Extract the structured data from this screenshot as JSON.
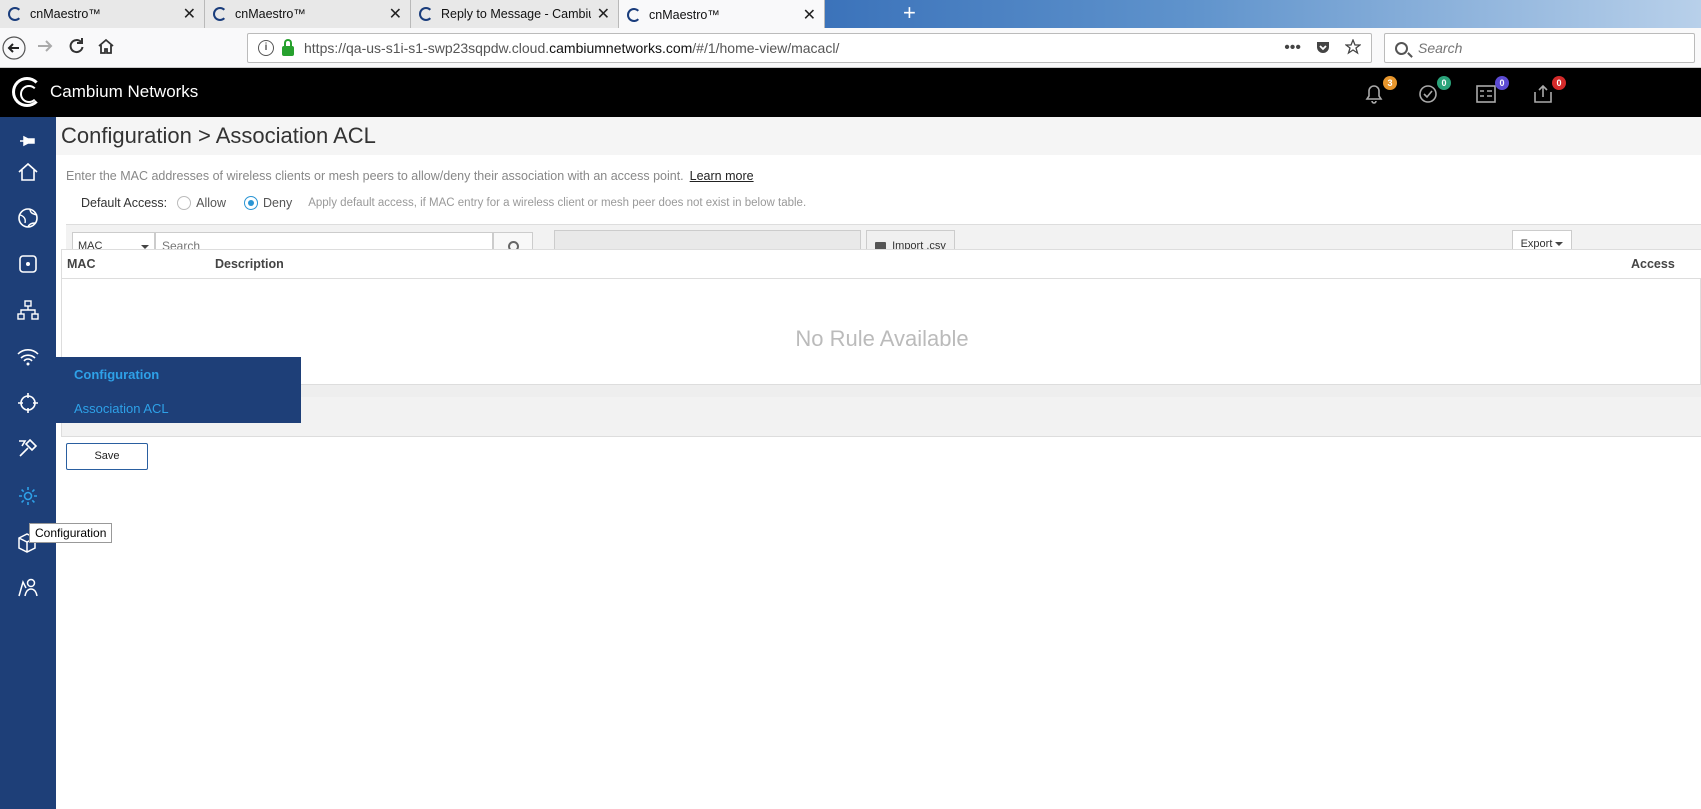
{
  "browser": {
    "tabs": [
      {
        "label": "cnMaestro™",
        "active": false
      },
      {
        "label": "cnMaestro™",
        "active": false
      },
      {
        "label": "Reply to Message - Cambium N",
        "active": false
      },
      {
        "label": "cnMaestro™",
        "active": true
      }
    ],
    "close_glyph": "✕",
    "new_tab_glyph": "+",
    "url_prefix": "https://qa-us-s1i-s1-swp23sqpdw.cloud.",
    "url_domain": "cambiumnetworks.com",
    "url_suffix": "/#/1/home-view/macacl/",
    "search_placeholder": "Search"
  },
  "app": {
    "brand": "Cambium Networks",
    "header_badges": {
      "alarms": "3",
      "tasks": "0",
      "jobs": "0",
      "updates": "0"
    },
    "badge_colors": {
      "alarms": "#e8962c",
      "tasks": "#2aa37a",
      "jobs": "#5c4bd3",
      "updates": "#d42a2a"
    }
  },
  "sidebar": {
    "items": [
      "pin-icon",
      "home-icon",
      "globe-icon",
      "device-icon",
      "network-icon",
      "wifi-icon",
      "target-icon",
      "tools-icon",
      "gear-icon",
      "box-add-icon",
      "users-icon"
    ],
    "tooltip": "Configuration",
    "flyout_title": "Configuration",
    "flyout_item": "Association ACL"
  },
  "page": {
    "title": "Configuration > Association ACL",
    "description": "Enter the MAC addresses of wireless clients or mesh peers to allow/deny their association with an access point.",
    "learn_more": "Learn more",
    "default_access_label": "Default Access:",
    "allow_label": "Allow",
    "deny_label": "Deny",
    "selected": "Deny",
    "hint": "Apply default access, if MAC entry for a wireless client or mesh peer does not exist in below table."
  },
  "toolbar": {
    "filter_value": "MAC",
    "search_placeholder": "Search",
    "import_label": "Import .csv",
    "export_label": "Export"
  },
  "table": {
    "columns": [
      "MAC",
      "Description",
      "Access"
    ],
    "empty_text": "No Rule Available"
  },
  "actions": {
    "save_label": "Save"
  }
}
